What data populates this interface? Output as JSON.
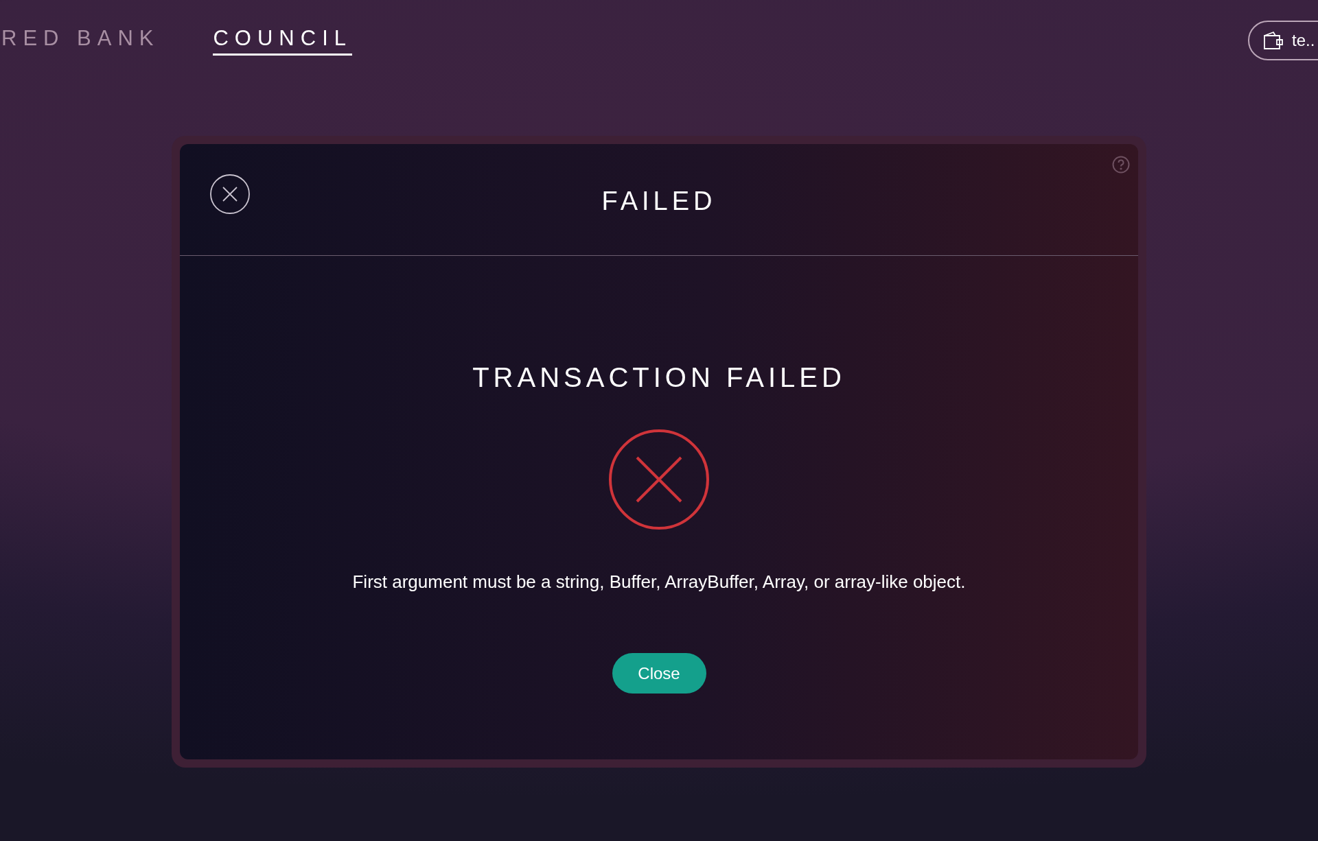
{
  "nav": {
    "tabs": [
      {
        "label": "RED BANK",
        "selected": false
      },
      {
        "label": "COUNCIL",
        "selected": true
      }
    ]
  },
  "wallet": {
    "label": "te.."
  },
  "modal": {
    "title": "FAILED",
    "heading": "TRANSACTION FAILED",
    "message": "First argument must be a string, Buffer, ArrayBuffer, Array, or array-like object.",
    "button": "Close"
  }
}
